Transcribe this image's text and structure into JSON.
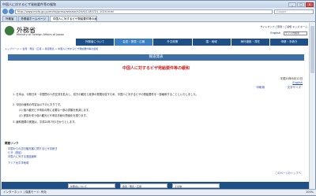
{
  "browser": {
    "title": "中国人に対するビザ発給要件等の緩和",
    "address": "http://www.mofa.go.jp/mofaj/press/release/h20/6/1180721_1020.html",
    "search_placeholder": "Google",
    "tabs": [
      "中国人に対するビザ発給要件等の緩和",
      "外務省",
      "外務省ホームページ"
    ],
    "status": "インターネット | 保護モード: 有効",
    "zoom": "100%"
  },
  "site": {
    "logo_ja": "外務省",
    "logo_en": "Ministry of Foreign Affairs of Japan",
    "top_links": "サイトマップ  ご意見・ご感想  キッズ  ホーム",
    "english_label": "English",
    "search_label": "サイト内検索",
    "nav": [
      "外務省について",
      "会見・発表・広報",
      "外交政策",
      "国・地域",
      "海外渡航・滞在",
      "申請・手続き"
    ]
  },
  "breadcrumb": "トップページ > 会見・発表・広報 > 報道発表 > 中国人に対するビザ発給要件等の緩和",
  "band_label": "報道発表",
  "article": {
    "title": "中国人に対するビザ発給要件等の緩和",
    "date": "平成20年6月12日",
    "english_link": "English",
    "links": [
      "印刷用",
      "文字サイズ"
    ],
    "paragraphs": [
      "1.  日本は、今般日本・中国間の人的交流を拡大し、双方の観光と経済の発展を促すため、中国人に対するビザの発給要件を一部緩和することといたしました。",
      "2.  今回の緩和の内容は以下のとおりです。",
      "(1)  個人観光ビザ申請の際に必要な一部の書類を削減します。",
      "(2)  家族を伴う個人観光ビザ申請手続の簡素化を図ります。",
      "3.  緩和措置の実施は、平成20年7月1日からとします。"
    ]
  },
  "related": {
    "heading": "関連リンク",
    "items": [
      "中国からの訪日観光客に関するビザ手続き",
      "ビザ（査証）",
      "中国人に対する査証緩和",
      "アジア太平洋地域"
    ]
  },
  "to_top": "このページのトップへ",
  "footer": [
    "外務省について",
    "会見・発表・広報",
    "その他"
  ]
}
